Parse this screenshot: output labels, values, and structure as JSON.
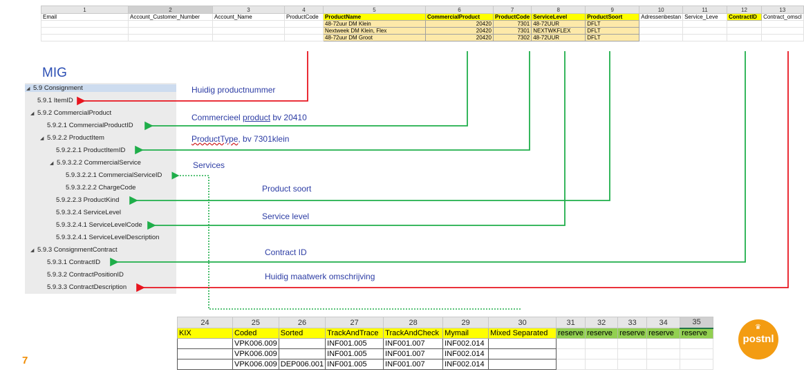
{
  "top_sheet": {
    "col_numbers": [
      "1",
      "2",
      "3",
      "4",
      "5",
      "6",
      "7",
      "8",
      "9",
      "10",
      "11",
      "12",
      "13"
    ],
    "headers": [
      "Email",
      "Account_Customer_Number",
      "Account_Name",
      "ProductCode",
      "ProductName",
      "CommercialProduct",
      "ProductCode",
      "ServiceLevel",
      "ProductSoort",
      "Adressenbestan",
      "Service_Leve",
      "ContractID",
      "Contract_omscl"
    ],
    "rows": [
      {
        "product_name": "48-72uur DM Klein",
        "commercial_product": "20420",
        "product_code": "7301",
        "service_level": "48-72UUR",
        "product_soort": "DFLT"
      },
      {
        "product_name": "Nextweek DM Klein, Flex",
        "commercial_product": "20420",
        "product_code": "7301",
        "service_level": "NEXTWKFLEX",
        "product_soort": "DFLT"
      },
      {
        "product_name": "48-72uur DM Groot",
        "commercial_product": "20420",
        "product_code": "7302",
        "service_level": "48-72UUR",
        "product_soort": "DFLT"
      }
    ]
  },
  "mig": {
    "title": "MIG",
    "tree": [
      "5.9 Consignment",
      "5.9.1 ItemID",
      "5.9.2 CommercialProduct",
      "5.9.2.1 CommercialProductID",
      "5.9.2.2 ProductItem",
      "5.9.2.2.1 ProductItemID",
      "5.9.3.2.2  CommercialService",
      "5.9.3.2.2.1 CommercialServiceID",
      "5.9.3.2.2.2 ChargeCode",
      "5.9.2.2.3 ProductKind",
      "5.9.3.2.4 ServiceLevel",
      "5.9.3.2.4.1  ServiceLevelCode",
      "5.9.3.2.4.1  ServiceLevelDescription",
      "5.9.3 ConsignmentContract",
      "5.9.3.1 ContractID",
      "5.9.3.2 ContractPositionID",
      "5.9.3.3 ContractDescription"
    ]
  },
  "annotations": {
    "huidig_productnummer": "Huidig productnummer",
    "commercieel_pre": "Commercieel ",
    "commercieel_product": "product",
    "commercieel_post": " bv 20410",
    "producttype_main": "ProductType",
    "producttype_post": ", bv 7301klein",
    "services": "Services",
    "product_soort": "Product soort",
    "service_level": "Service level",
    "contract_id": "Contract ID",
    "huidig_maatwerk": "Huidig maatwerk omschrijving"
  },
  "bottom_sheet": {
    "col_numbers": [
      "24",
      "25",
      "26",
      "27",
      "28",
      "29",
      "30",
      "31",
      "32",
      "33",
      "34",
      "35"
    ],
    "headers": [
      "KIX",
      "Coded",
      "Sorted",
      "TrackAndTrace",
      "TrackAndCheck",
      "Mymail",
      "Mixed Separated",
      "reserve",
      "reserve",
      "reserve",
      "reserve",
      "reserve"
    ],
    "rows": [
      [
        "",
        "VPK006.009",
        "",
        "INF001.005",
        "INF001.007",
        "INF002.014",
        "",
        "",
        "",
        "",
        "",
        ""
      ],
      [
        "",
        "VPK006.009",
        "",
        "INF001.005",
        "INF001.007",
        "INF002.014",
        "",
        "",
        "",
        "",
        "",
        ""
      ],
      [
        "",
        "VPK006.009",
        "DEP006.001",
        "INF001.005",
        "INF001.007",
        "INF002.014",
        "",
        "",
        "",
        "",
        "",
        ""
      ]
    ]
  },
  "footer": {
    "page_number": "7",
    "logo_text": "postnl",
    "logo_crown": "♛"
  },
  "colors": {
    "red_arrow": "#e8141e",
    "green_arrow": "#1fae4a",
    "yellow_header": "#ffff00",
    "green_header": "#92d050",
    "note_text": "#2c3ca4",
    "postnl_orange": "#f39c12"
  }
}
